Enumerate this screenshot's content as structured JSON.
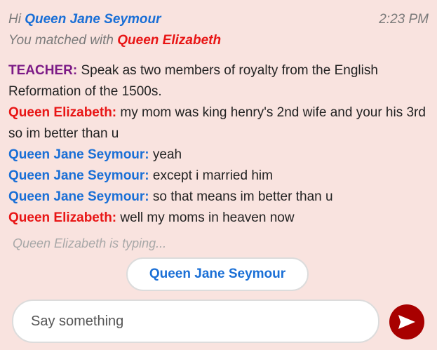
{
  "header": {
    "greeting": "Hi",
    "user_name": "Queen Jane Seymour",
    "time": "2:23 PM",
    "matched_text": "You matched with",
    "match_name": "Queen Elizabeth"
  },
  "messages": [
    {
      "speaker": "TEACHER:",
      "text": "Speak as two members of royalty from the English Reformation of the 1500s."
    },
    {
      "speaker": "Queen Elizabeth:",
      "text": "my mom was king henry's 2nd wife and your his 3rd so im better than u"
    },
    {
      "speaker": "Queen Jane Seymour:",
      "text": "yeah"
    },
    {
      "speaker": "Queen Jane Seymour:",
      "text": "except i married him"
    },
    {
      "speaker": "Queen Jane Seymour:",
      "text": "so that means im better than u"
    },
    {
      "speaker": "Queen Elizabeth:",
      "text": "well my moms in heaven now"
    }
  ],
  "typing_indicator": "Queen Elizabeth is typing...",
  "role_button": "Queen Jane Seymour",
  "composer": {
    "placeholder": "Say something"
  },
  "colors": {
    "background": "#f9e3df",
    "user_name": "#1a6fd6",
    "match_name": "#e81515",
    "teacher": "#7c1a86",
    "send_button": "#a80000"
  },
  "icons": {
    "send": "send-arrow-icon"
  }
}
